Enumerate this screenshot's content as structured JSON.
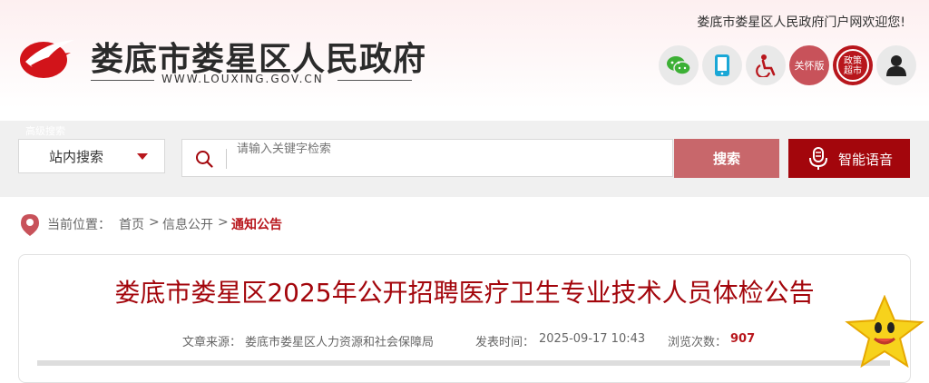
{
  "header": {
    "site_name": "娄底市娄星区人民政府",
    "site_url": "WWW.LOUXING.GOV.CN",
    "welcome": "娄底市娄星区人民政府门户网欢迎您!",
    "tools": [
      {
        "icon": "wechat-icon"
      },
      {
        "icon": "mobile-icon"
      },
      {
        "icon": "accessibility-icon"
      },
      {
        "label": "关怀版"
      },
      {
        "label_top": "政策",
        "label_bottom": "超市"
      },
      {
        "icon": "user-icon"
      }
    ]
  },
  "search": {
    "scope_label": "站内搜索",
    "tag": "高级搜索",
    "placeholder": "请输入关键字检索",
    "button_label": "搜索",
    "voice_label": "智能语音"
  },
  "breadcrumb": {
    "prefix": "当前位置：",
    "items": [
      "首页",
      "信息公开",
      "通知公告"
    ],
    "separator": ">"
  },
  "article": {
    "title": "娄底市娄星区2025年公开招聘医疗卫生专业技术人员体检公告",
    "source_label": "文章来源：",
    "source": "娄底市娄星区人力资源和社会保障局",
    "time_label": "发表时间：",
    "time": "2025-09-17 10:43",
    "views_label": "浏览次数：",
    "views": "907"
  },
  "colors": {
    "brand_red": "#b8161c",
    "dark_red": "#a3060c",
    "search_btn": "#c8676b"
  }
}
